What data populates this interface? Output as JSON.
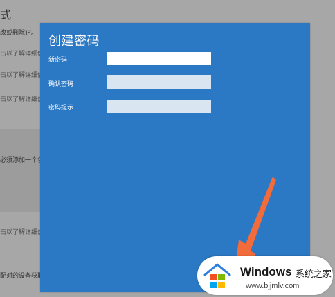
{
  "background": {
    "title": "式",
    "lines": [
      "改或删除它。",
      "击以了解详细信",
      "击以了解详细信",
      "击以了解详细信",
      "必须添加一个包",
      "击以了解详细信",
      "配对的设备获取"
    ]
  },
  "dialog": {
    "title": "创建密码",
    "fields": [
      {
        "label": "新密码",
        "value": ""
      },
      {
        "label": "确认密码",
        "value": ""
      },
      {
        "label": "密码提示",
        "value": ""
      }
    ]
  },
  "watermark": {
    "brand": "Windows",
    "brand_cn": "系统之家",
    "url": "www.bjjmlv.com"
  },
  "colors": {
    "dialog_bg": "#2b78c4",
    "arrow": "#f26b3a",
    "overlay": "#a7a7a7"
  }
}
